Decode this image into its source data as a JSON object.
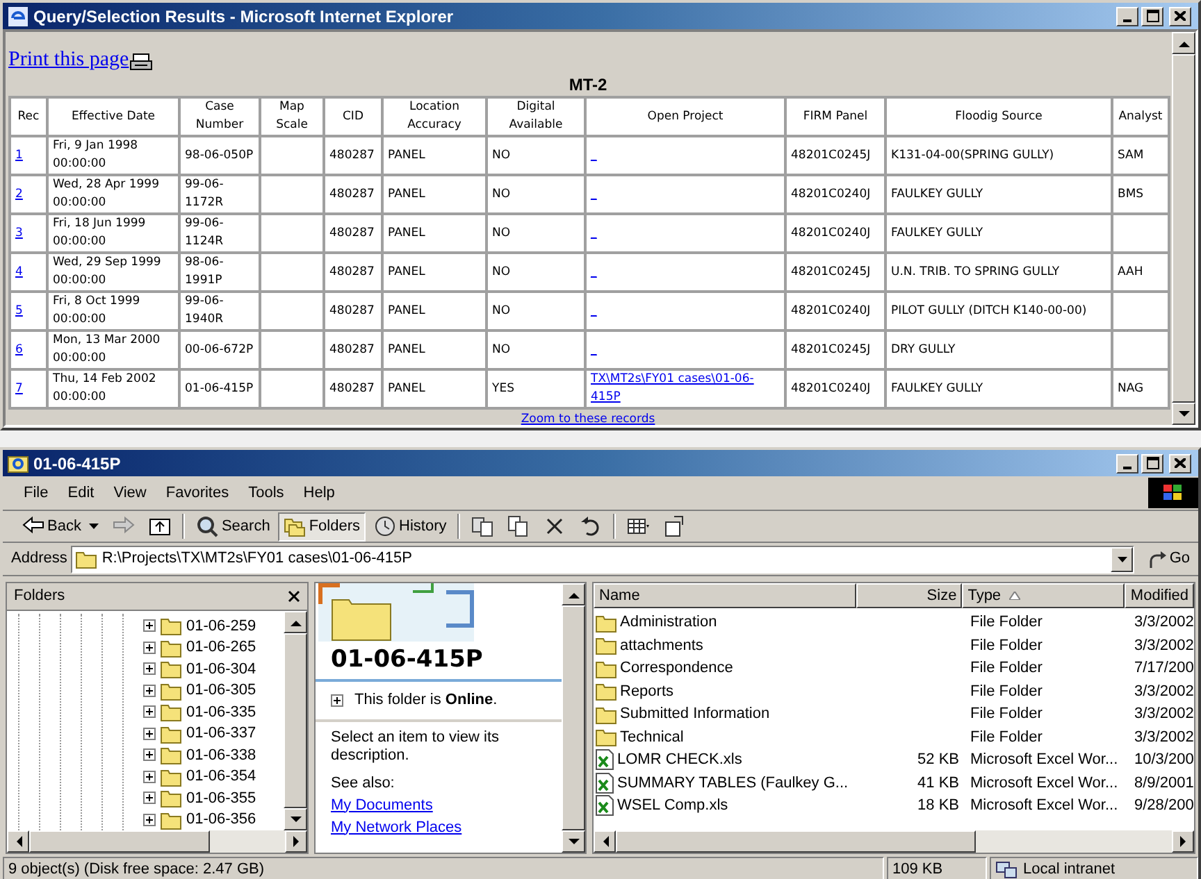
{
  "browser_window": {
    "title": "Query/Selection Results - Microsoft Internet Explorer",
    "print_link": "Print this page",
    "table_title": "MT-2",
    "columns": [
      "Rec",
      "Effective Date",
      "Case Number",
      "Map Scale",
      "CID",
      "Location Accuracy",
      "Digital Available",
      "Open Project",
      "FIRM Panel",
      "Floodig Source",
      "Analyst"
    ],
    "rows": [
      {
        "rec": "1",
        "effective_date": "Fri, 9 Jan 1998 00:00:00",
        "case_number": "98-06-050P",
        "cid": "480287",
        "location_accuracy": "PANEL",
        "digital_available": "NO",
        "open_project": "_",
        "firm_panel": "48201C0245J",
        "flooding_source": "K131-04-00(SPRING GULLY)",
        "analyst": "SAM"
      },
      {
        "rec": "2",
        "effective_date": "Wed, 28 Apr 1999 00:00:00",
        "case_number": "99-06-1172R",
        "cid": "480287",
        "location_accuracy": "PANEL",
        "digital_available": "NO",
        "open_project": "_",
        "firm_panel": "48201C0240J",
        "flooding_source": "FAULKEY GULLY",
        "analyst": "BMS"
      },
      {
        "rec": "3",
        "effective_date": "Fri, 18 Jun 1999 00:00:00",
        "case_number": "99-06-1124R",
        "cid": "480287",
        "location_accuracy": "PANEL",
        "digital_available": "NO",
        "open_project": "_",
        "firm_panel": "48201C0240J",
        "flooding_source": "FAULKEY GULLY"
      },
      {
        "rec": "4",
        "effective_date": "Wed, 29 Sep 1999 00:00:00",
        "case_number": "98-06-1991P",
        "cid": "480287",
        "location_accuracy": "PANEL",
        "digital_available": "NO",
        "open_project": "_",
        "firm_panel": "48201C0245J",
        "flooding_source": "U.N. TRIB. TO SPRING GULLY",
        "analyst": "AAH"
      },
      {
        "rec": "5",
        "effective_date": "Fri, 8 Oct 1999 00:00:00",
        "case_number": "99-06-1940R",
        "cid": "480287",
        "location_accuracy": "PANEL",
        "digital_available": "NO",
        "open_project": "_",
        "firm_panel": "48201C0240J",
        "flooding_source": "PILOT GULLY (DITCH K140-00-00)"
      },
      {
        "rec": "6",
        "effective_date": "Mon, 13 Mar 2000 00:00:00",
        "case_number": "00-06-672P",
        "cid": "480287",
        "location_accuracy": "PANEL",
        "digital_available": "NO",
        "open_project": "_",
        "firm_panel": "48201C0245J",
        "flooding_source": "DRY GULLY"
      },
      {
        "rec": "7",
        "effective_date": "Thu, 14 Feb 2002 00:00:00",
        "case_number": "01-06-415P",
        "cid": "480287",
        "location_accuracy": "PANEL",
        "digital_available": "YES",
        "open_project": "TX\\MT2s\\FY01 cases\\01-06-415P",
        "firm_panel": "48201C0240J",
        "flooding_source": "FAULKEY GULLY",
        "analyst": "NAG"
      }
    ],
    "zoom_link": "Zoom to these records"
  },
  "explorer_window": {
    "title": "01-06-415P",
    "menu": [
      "File",
      "Edit",
      "View",
      "Favorites",
      "Tools",
      "Help"
    ],
    "toolbar": [
      {
        "kind": "back",
        "label": "Back",
        "selected": false
      },
      {
        "kind": "forward",
        "selected": false
      },
      {
        "kind": "up",
        "selected": false
      },
      {
        "kind": "search",
        "label": "Search",
        "selected": false
      },
      {
        "kind": "folders",
        "label": "Folders",
        "selected": true
      },
      {
        "kind": "history",
        "label": "History",
        "selected": false
      },
      {
        "kind": "move",
        "selected": false
      },
      {
        "kind": "copy",
        "selected": false
      },
      {
        "kind": "delete",
        "selected": false
      },
      {
        "kind": "undo",
        "selected": false
      },
      {
        "kind": "views",
        "selected": false
      },
      {
        "kind": "properties",
        "selected": false
      }
    ],
    "address": {
      "label": "Address",
      "value": "R:\\Projects\\TX\\MT2s\\FY01 cases\\01-06-415P",
      "go": "Go"
    },
    "folders_pane": {
      "title": "Folders",
      "items": [
        "01-06-259",
        "01-06-265",
        "01-06-304",
        "01-06-305",
        "01-06-335",
        "01-06-337",
        "01-06-338",
        "01-06-354",
        "01-06-355",
        "01-06-356"
      ]
    },
    "web_view": {
      "heading": "01-06-415P",
      "online": "This folder is **Online**.",
      "hint": "Select an item to view its description.",
      "see_also": "See also:",
      "links": [
        "My Documents",
        "My Network Places"
      ]
    },
    "file_list": {
      "columns": [
        {
          "label": "Name",
          "sorted": false
        },
        {
          "label": "Size",
          "sorted": false
        },
        {
          "label": "Type",
          "sorted": true
        },
        {
          "label": "Modified",
          "sorted": false
        }
      ],
      "rows": [
        {
          "kind": "folder",
          "name": "Administration",
          "type": "File Folder",
          "modified": "3/3/2002"
        },
        {
          "kind": "folder",
          "name": "attachments",
          "type": "File Folder",
          "modified": "3/3/2002"
        },
        {
          "kind": "folder",
          "name": "Correspondence",
          "type": "File Folder",
          "modified": "7/17/200"
        },
        {
          "kind": "folder",
          "name": "Reports",
          "type": "File Folder",
          "modified": "3/3/2002"
        },
        {
          "kind": "folder",
          "name": "Submitted Information",
          "type": "File Folder",
          "modified": "3/3/2002"
        },
        {
          "kind": "folder",
          "name": "Technical",
          "type": "File Folder",
          "modified": "3/3/2002"
        },
        {
          "kind": "excel",
          "name": "LOMR CHECK.xls",
          "size": "52 KB",
          "type": "Microsoft Excel Wor...",
          "modified": "10/3/200"
        },
        {
          "kind": "excel",
          "name": "SUMMARY TABLES (Faulkey G...",
          "size": "41 KB",
          "type": "Microsoft Excel Wor...",
          "modified": "8/9/2001"
        },
        {
          "kind": "excel",
          "name": "WSEL Comp.xls",
          "size": "18 KB",
          "type": "Microsoft Excel Wor...",
          "modified": "9/28/200"
        }
      ]
    },
    "status_bar": [
      "9 object(s) (Disk free space: 2.47 GB)",
      "109 KB",
      "Local intranet"
    ]
  }
}
